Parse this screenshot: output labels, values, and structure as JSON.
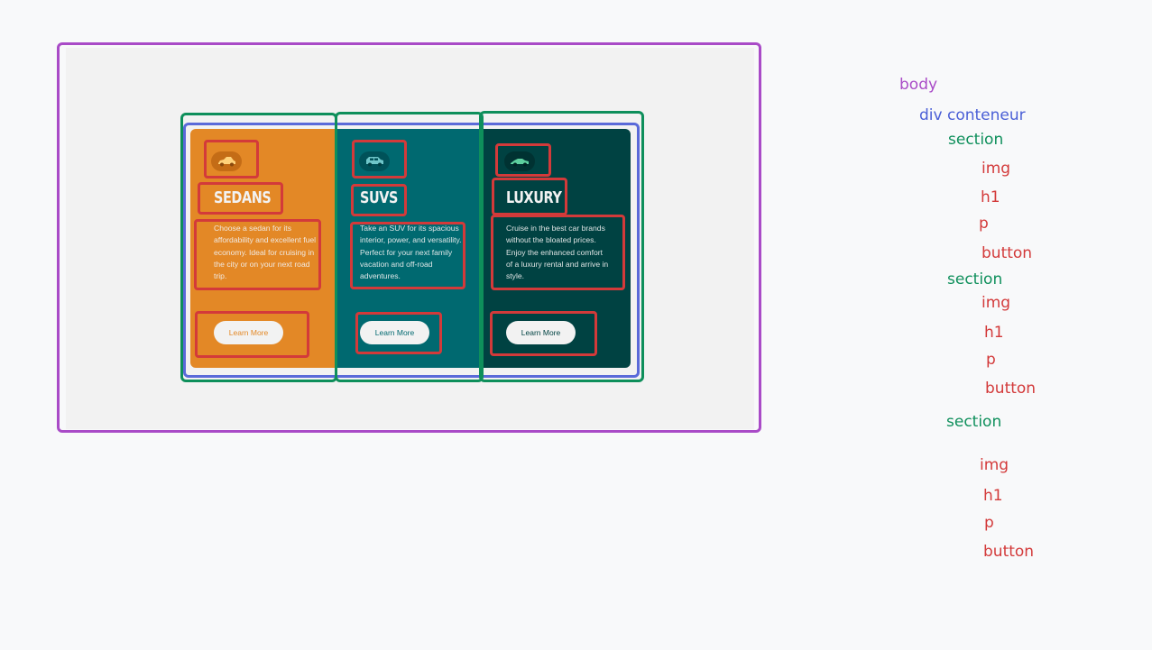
{
  "colors": {
    "body_outline": "#a94bc7",
    "div_outline": "#5a6ad9",
    "section_outline": "#0e8f5b",
    "element_outline": "#d33a3a",
    "sedans": "#e38826",
    "suvs": "#006970",
    "luxury": "#004242"
  },
  "cards": [
    {
      "icon": "sedan-car-icon",
      "title": "SEDANS",
      "text": "Choose a sedan for its affordability and excellent fuel economy. Ideal for cruising in the city or on your next road trip.",
      "button": "Learn More"
    },
    {
      "icon": "suv-car-icon",
      "title": "SUVS",
      "text": "Take an SUV for its spacious interior, power, and versatility. Perfect for your next family vacation and off-road adventures.",
      "button": "Learn More"
    },
    {
      "icon": "luxury-car-icon",
      "title": "LUXURY",
      "text": "Cruise in the best car brands without the bloated prices. Enjoy the enhanced comfort of a luxury rental and arrive in style.",
      "button": "Learn More"
    }
  ],
  "tree": {
    "body": "body",
    "div": "div conteneur",
    "section": "section",
    "img": "img",
    "h1": "h1",
    "p": "p",
    "button": "button"
  }
}
